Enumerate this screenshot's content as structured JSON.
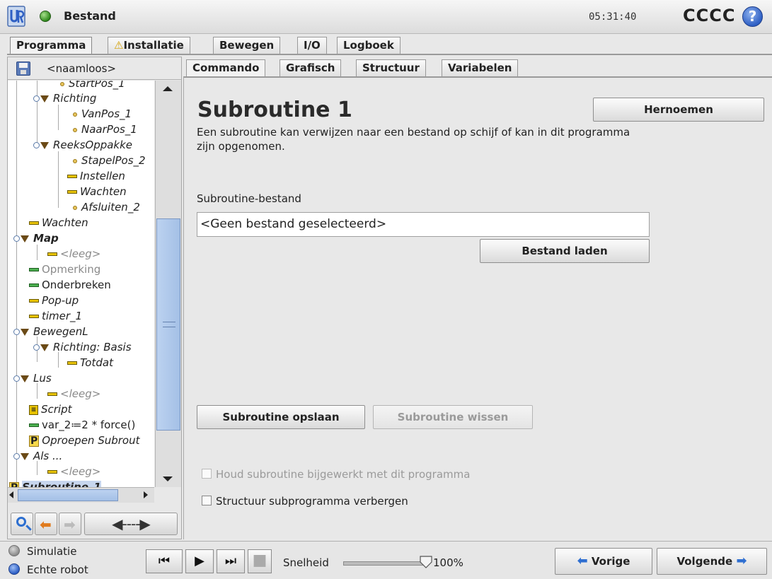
{
  "header": {
    "title": "Bestand",
    "clock": "05:31:40",
    "robot_name": "CCCC",
    "help_icon": "?"
  },
  "main_tabs": [
    {
      "label": "Programma",
      "active": true
    },
    {
      "label": "Installatie",
      "warning": true,
      "icon": "warning-icon"
    },
    {
      "label": "Bewegen"
    },
    {
      "label": "I/O"
    },
    {
      "label": "Logboek"
    }
  ],
  "program": {
    "file_name": "<naamloos>"
  },
  "tree": [
    {
      "label": "StartPos_1"
    },
    {
      "label": "Richting"
    },
    {
      "label": "VanPos_1"
    },
    {
      "label": "NaarPos_1"
    },
    {
      "label": "ReeksOppakke"
    },
    {
      "label": "StapelPos_2"
    },
    {
      "label": "Instellen"
    },
    {
      "label": "Wachten"
    },
    {
      "label": "Afsluiten_2"
    },
    {
      "label": "Wachten"
    },
    {
      "label": "Map"
    },
    {
      "label": "<leeg>"
    },
    {
      "label": "Opmerking"
    },
    {
      "label": "Onderbreken"
    },
    {
      "label": "Pop-up"
    },
    {
      "label": "timer_1"
    },
    {
      "label": "BewegenL"
    },
    {
      "label": "Richting: Basis"
    },
    {
      "label": "Totdat"
    },
    {
      "label": "Lus"
    },
    {
      "label": "<leeg>"
    },
    {
      "label": "Script"
    },
    {
      "label": "var_2≔2 * force()"
    },
    {
      "label": "Oproepen Subrout"
    },
    {
      "label": "Als ..."
    },
    {
      "label": "<leeg>"
    },
    {
      "label": "Subroutine_1"
    }
  ],
  "sub_tabs": [
    {
      "label": "Commando",
      "active": true
    },
    {
      "label": "Grafisch"
    },
    {
      "label": "Structuur"
    },
    {
      "label": "Variabelen"
    }
  ],
  "command": {
    "title": "Subroutine 1",
    "description": "Een subroutine kan verwijzen naar een bestand op schijf of kan in dit programma zijn opgenomen.",
    "rename_label": "Hernoemen",
    "file_label": "Subroutine-bestand",
    "file_value": "<Geen bestand geselecteerd>",
    "load_label": "Bestand laden",
    "save_label": "Subroutine opslaan",
    "clear_label": "Subroutine wissen",
    "keep_updated_label": "Houd subroutine bijgewerkt met dit programma",
    "keep_updated_checked": false,
    "hide_tree_label": "Structuur subprogramma verbergen",
    "hide_tree_checked": false
  },
  "footer": {
    "simulation_label": "Simulatie",
    "real_robot_label": "Echte robot",
    "mode_selected": "Echte robot",
    "speed_label": "Snelheid",
    "speed_value": "100%",
    "speed_fraction": 1.0,
    "prev_label": "Vorige",
    "next_label": "Volgende"
  },
  "colors": {
    "accent_blue": "#2e5fc4",
    "status_green": "#2f8a1c",
    "warning_yellow": "#d4a000"
  }
}
